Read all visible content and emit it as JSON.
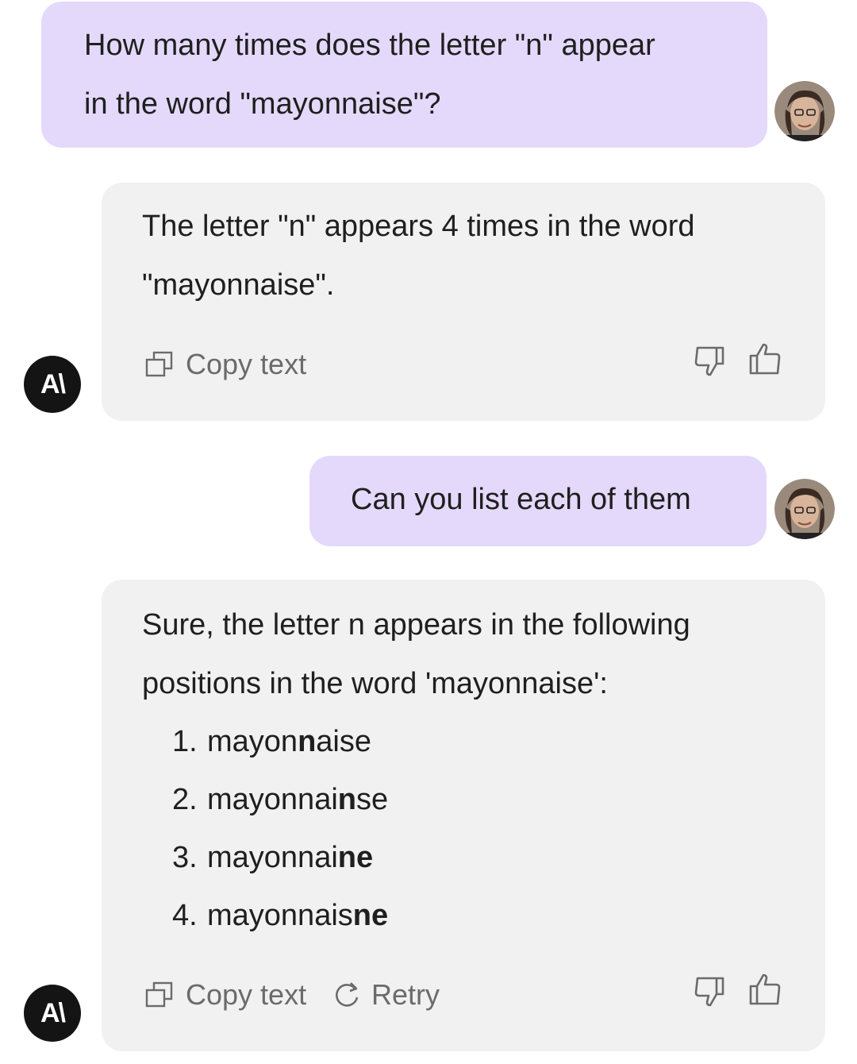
{
  "messages": [
    {
      "role": "user",
      "text_line1": "How many times does the letter \"n\" appear",
      "text_line2": "in the word \"mayonnaise\"?"
    },
    {
      "role": "assistant",
      "text_line1": "The letter \"n\" appears 4 times in the word",
      "text_line2": "\"mayonnaise\".",
      "copy_label": "Copy text"
    },
    {
      "role": "user",
      "text": "Can you list each of them"
    },
    {
      "role": "assistant",
      "text_line1": "Sure, the letter n appears in the following",
      "text_line2": "positions in the word 'mayonnaise':",
      "list": [
        {
          "num": "1.",
          "pre": "mayon",
          "bold": "n",
          "post": "aise"
        },
        {
          "num": "2.",
          "pre": "mayonnai",
          "bold": "n",
          "post": "se"
        },
        {
          "num": "3.",
          "pre": "mayonnai",
          "bold": "ne",
          "post": ""
        },
        {
          "num": "4.",
          "pre": "mayonnais",
          "bold": "ne",
          "post": ""
        }
      ],
      "copy_label": "Copy text",
      "retry_label": "Retry"
    }
  ],
  "assistant_logo": "A\\",
  "icons": [
    "copy-icon",
    "retry-icon",
    "thumbs-down-icon",
    "thumbs-up-icon",
    "user-avatar",
    "assistant-logo"
  ]
}
